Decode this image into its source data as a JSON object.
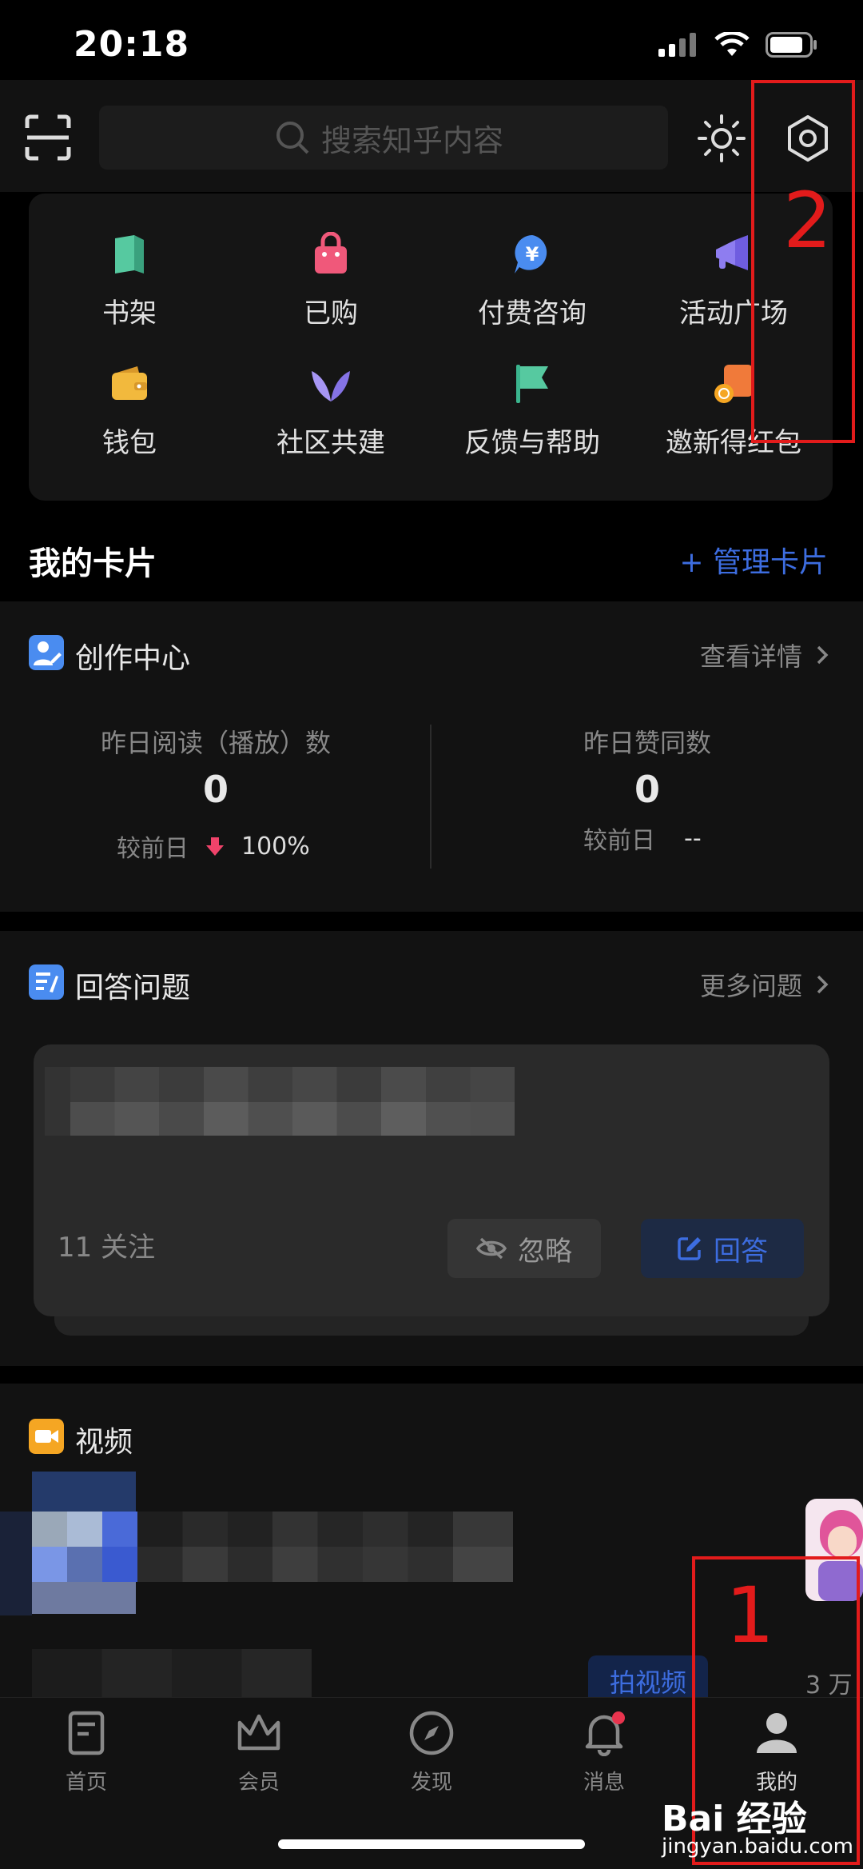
{
  "status_bar": {
    "time": "20:18"
  },
  "search": {
    "placeholder": "搜索知乎内容"
  },
  "grid": {
    "bookshelf": "书架",
    "purchased": "已购",
    "paid_consult": "付费咨询",
    "events": "活动广场",
    "wallet": "钱包",
    "community": "社区共建",
    "feedback": "反馈与帮助",
    "invite": "邀新得红包"
  },
  "my_cards": {
    "title": "我的卡片",
    "manage": "+ 管理卡片"
  },
  "creation_center": {
    "title": "创作中心",
    "link": "查看详情",
    "reads_label": "昨日阅读（播放）数",
    "reads_value": "0",
    "reads_cmp_label": "较前日",
    "reads_cmp_value": "100%",
    "likes_label": "昨日赞同数",
    "likes_value": "0",
    "likes_cmp_label": "较前日",
    "likes_cmp_value": "--"
  },
  "answer_questions": {
    "title": "回答问题",
    "link": "更多问题",
    "followers": "11 关注",
    "ignore": "忽略",
    "answer": "回答"
  },
  "video": {
    "title": "视频",
    "shoot": "拍视频",
    "count": "3 万"
  },
  "tabs": {
    "home": "首页",
    "vip": "会员",
    "discover": "发现",
    "messages": "消息",
    "me": "我的"
  },
  "annotations": {
    "one": "1",
    "two": "2"
  },
  "watermark": {
    "brand": "Bai 经验",
    "url": "jingyan.baidu.com"
  },
  "colors": {
    "accent": "#3d6de0",
    "annotation": "#e21b1b",
    "down_arrow": "#f0436a"
  }
}
